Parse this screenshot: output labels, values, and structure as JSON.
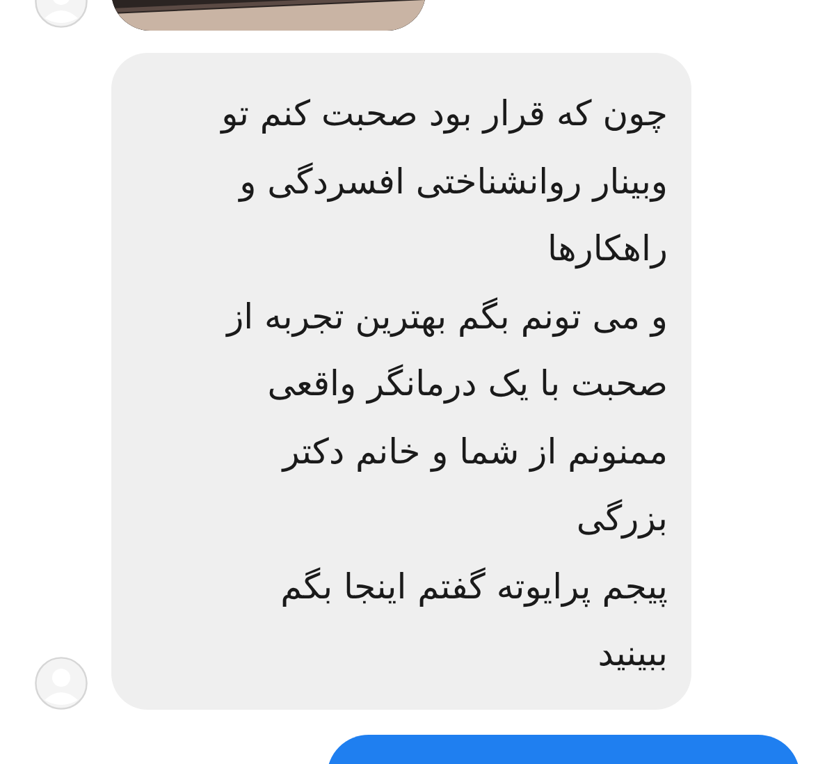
{
  "message": {
    "lines": [
      "چون که قرار بود صحبت کنم تو",
      "وبینار روانشناختی افسردگی و",
      "راهکارها",
      "و می تونم بگم بهترین تجربه از",
      "صحبت با یک درمانگر واقعی",
      "ممنونم از شما و خانم دکتر",
      "بزرگی",
      "پیجم پرایوته گفتم اینجا بگم",
      "ببینید"
    ]
  },
  "reply_message": {
    "kind": "bubble"
  }
}
